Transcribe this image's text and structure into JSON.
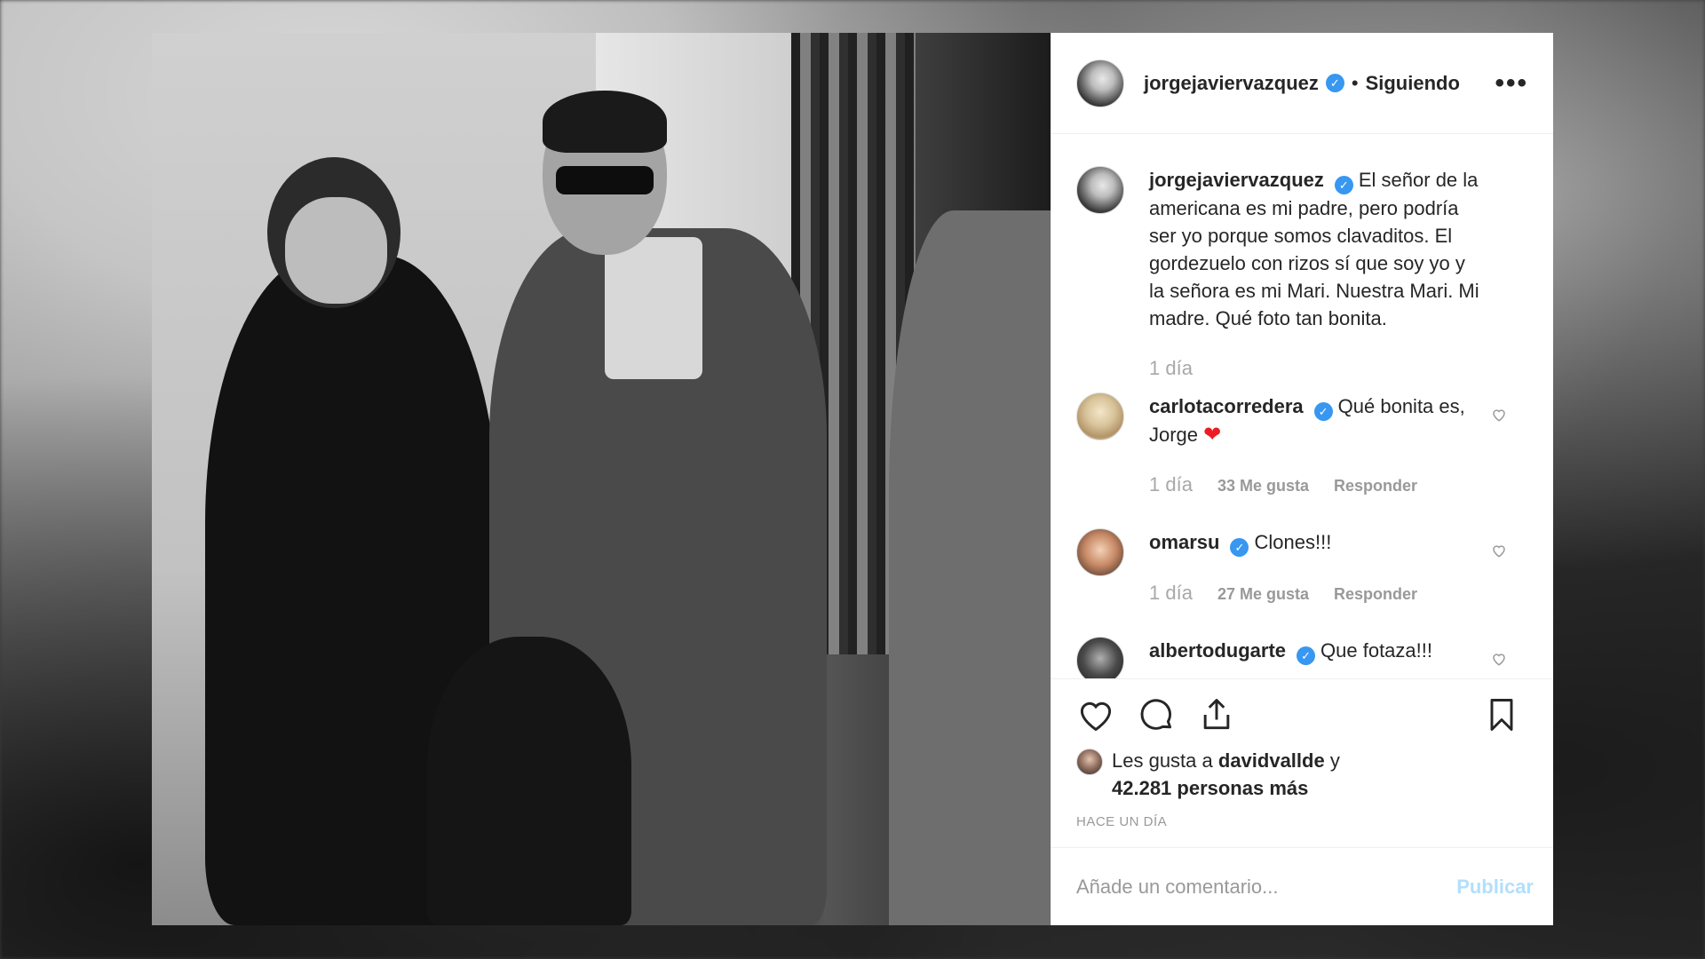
{
  "post": {
    "author": "jorgejaviervazquez",
    "verified_mark": "✓",
    "separator": "•",
    "follow_status": "Siguiendo",
    "more": "•••"
  },
  "caption": {
    "author": "jorgejaviervazquez",
    "text": "El señor de la americana es mi padre, pero podría ser yo porque somos clavaditos. El gordezuelo con rizos sí que soy yo y la señora es mi Mari. Nuestra Mari. Mi madre. Qué foto tan bonita.",
    "time": "1 día"
  },
  "comments": [
    {
      "user": "carlotacorredera",
      "text": "Qué bonita es, Jorge",
      "emoji": "❤",
      "time": "1 día",
      "likes": "33 Me gusta",
      "reply": "Responder"
    },
    {
      "user": "omarsu",
      "text": "Clones!!!",
      "time": "1 día",
      "likes": "27 Me gusta",
      "reply": "Responder"
    },
    {
      "user": "albertodugarte",
      "text": "Que fotaza!!!"
    }
  ],
  "likes": {
    "prefix": "Les gusta a",
    "user": "davidvallde",
    "conjunction": "y",
    "others": "42.281 personas más"
  },
  "timestamp": "HACE UN DÍA",
  "add_comment": {
    "placeholder": "Añade un comentario...",
    "publish": "Publicar"
  },
  "colors": {
    "accent": "#3897f0",
    "publish_disabled": "#b2dffc",
    "text": "#262626",
    "muted": "#999999"
  },
  "icons": [
    "heart-icon",
    "comment-icon",
    "share-icon",
    "bookmark-icon",
    "more-icon",
    "verified-icon"
  ]
}
